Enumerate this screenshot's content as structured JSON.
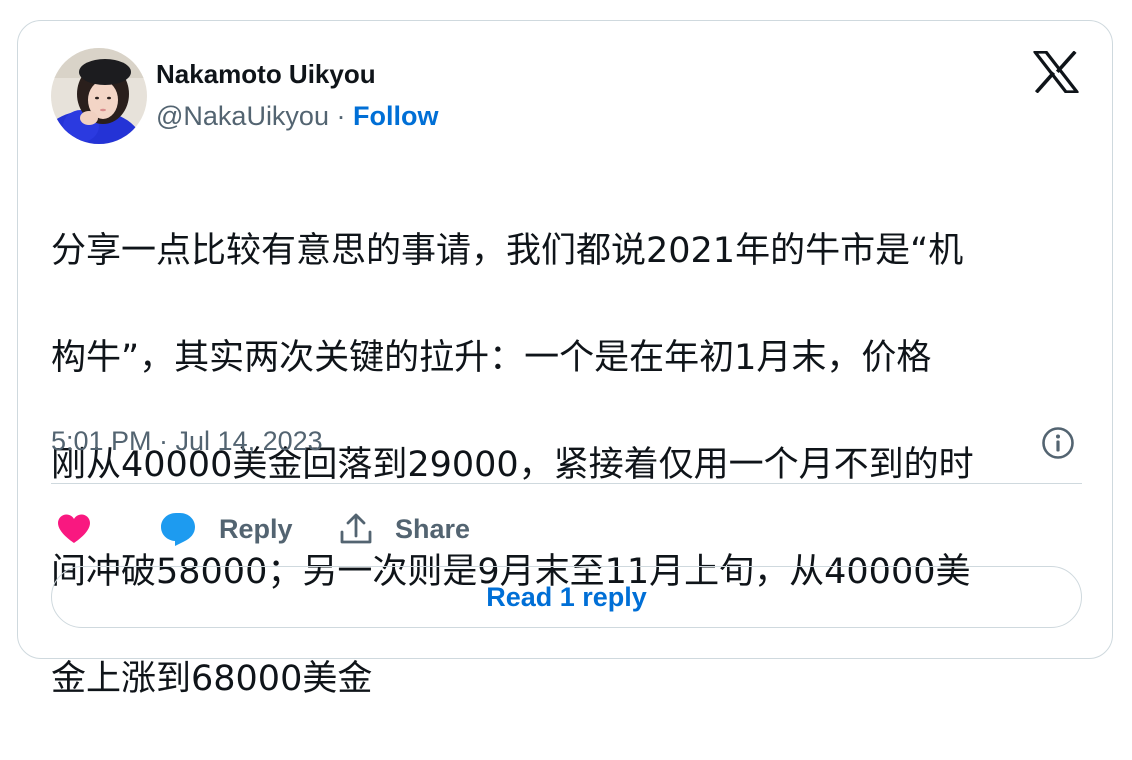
{
  "author": {
    "name": "Nakamoto Uikyou",
    "handle": "@NakaUikyou",
    "separator": "·",
    "follow_label": "Follow"
  },
  "tweet": {
    "text_lines": [
      "分享一点比较有意思的事请，我们都说2021年的牛市是“机",
      "构牛”，其实两次关键的拉升：一个是在年初1月末，价格",
      "刚从40000美金回落到29000，紧接着仅用一个月不到的时",
      "间冲破58000；另一次则是9月末至11月上旬，从40000美",
      "金上涨到68000美金"
    ],
    "timestamp": "5:01 PM · Jul 14, 2023"
  },
  "actions": {
    "reply_label": "Reply",
    "share_label": "Share"
  },
  "read_replies_label": "Read 1 reply",
  "colors": {
    "like": "#f91880",
    "reply_icon": "#1d9bf0",
    "link": "#006fd6",
    "secondary_text": "#536471",
    "border": "#cfd9de"
  },
  "icons": {
    "brand": "x-logo-icon",
    "info": "info-icon",
    "like": "heart-icon",
    "reply": "speech-bubble-icon",
    "share": "share-upload-icon"
  }
}
